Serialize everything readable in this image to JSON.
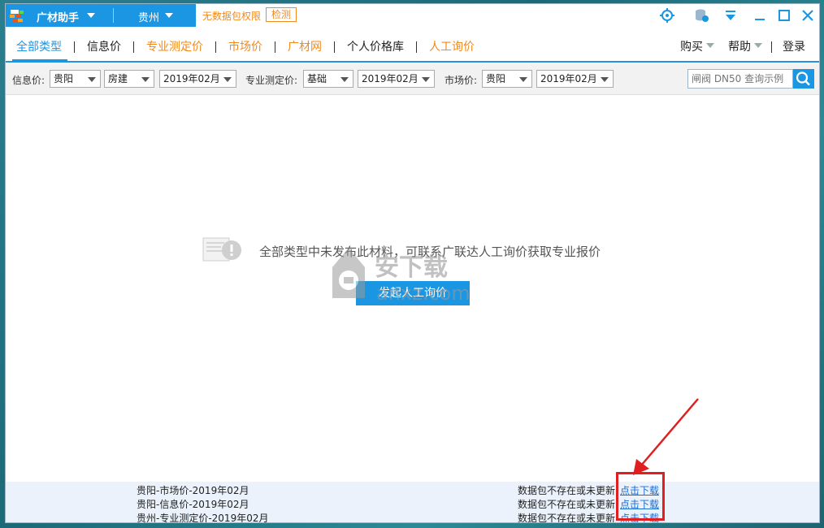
{
  "titlebar": {
    "app_name": "广材助手",
    "city": "贵州",
    "no_data": "无数据包权限",
    "check_label": "检测"
  },
  "nav": {
    "items": [
      {
        "label": "全部类型",
        "state": "active"
      },
      {
        "label": "信息价",
        "state": "normal"
      },
      {
        "label": "专业测定价",
        "state": "orange"
      },
      {
        "label": "市场价",
        "state": "orange"
      },
      {
        "label": "广材网",
        "state": "orange"
      },
      {
        "label": "个人价格库",
        "state": "normal"
      },
      {
        "label": "人工询价",
        "state": "orange"
      }
    ],
    "buy": "购买",
    "help": "帮助",
    "login": "登录"
  },
  "filters": {
    "info_label": "信息价:",
    "info_city": "贵阳",
    "info_type": "房建",
    "info_date": "2019年02月",
    "pro_label": "专业测定价:",
    "pro_type": "基础",
    "pro_date": "2019年02月",
    "market_label": "市场价:",
    "market_city": "贵阳",
    "market_date": "2019年02月",
    "search_placeholder": "闸阀 DN50 查询示例"
  },
  "content": {
    "empty_message": "全部类型中未发布此材料，可联系广联达人工询价获取专业报价",
    "ask_button": "发起人工询价"
  },
  "footer": {
    "rows": [
      {
        "name": "贵阳-市场价-2019年02月",
        "status": "数据包不存在或未更新",
        "link": "点击下载"
      },
      {
        "name": "贵阳-信息价-2019年02月",
        "status": "数据包不存在或未更新",
        "link": "点击下载"
      },
      {
        "name": "贵州-专业测定价-2019年02月",
        "status": "数据包不存在或未更新",
        "link": "点击下载"
      }
    ]
  },
  "colors": {
    "accent": "#1a96e3",
    "orange": "#f08a1c",
    "annotation_red": "#e02020",
    "link": "#1a6fd1"
  },
  "watermark": {
    "brand": "安下载",
    "url": "anxz.com"
  }
}
